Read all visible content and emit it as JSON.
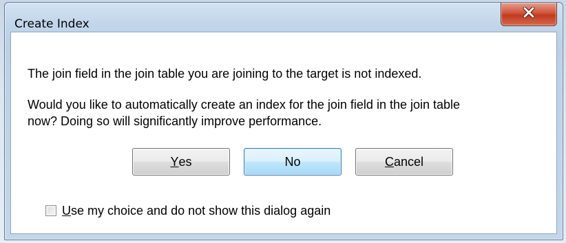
{
  "window": {
    "title": "Create Index"
  },
  "dialog": {
    "message_line1": "The join field in the join table you are joining to the target is not indexed.",
    "message_line2": "Would you like to automatically create an index for the join field in the join table\nnow? Doing so will significantly improve performance.",
    "buttons": {
      "yes": {
        "mnemonic": "Y",
        "rest": "es"
      },
      "no": {
        "label": "No"
      },
      "cancel": {
        "mnemonic": "C",
        "rest": "ancel"
      }
    },
    "checkbox": {
      "mnemonic": "U",
      "rest": "se my choice and do not show this dialog again",
      "checked": false
    }
  },
  "icons": {
    "close": "close-icon"
  },
  "colors": {
    "close_button": "#c74a2f",
    "default_button_border": "#3c7fb1"
  }
}
